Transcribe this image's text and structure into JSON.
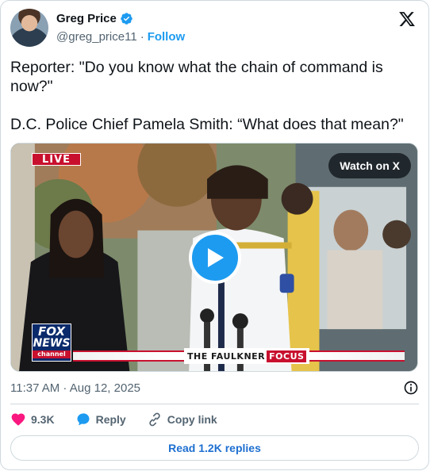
{
  "author": {
    "name": "Greg Price",
    "handle": "@greg_price11",
    "separator": "·",
    "follow_label": "Follow",
    "verified_color": "#1d9bf0"
  },
  "tweet": {
    "line1": "Reporter: \"Do you know what the chain of command is now?\"",
    "line2": "D.C. Police Chief Pamela Smith: “What does that mean?\""
  },
  "media": {
    "watch_label": "Watch on X",
    "live_label": "LIVE",
    "network_line1": "FOX",
    "network_line2": "NEWS",
    "network_line3": "channel",
    "show_part1": "THE FAULKNER",
    "show_part2": "FOCUS",
    "play_icon": "play-icon"
  },
  "timestamp": "11:37 AM · Aug 12, 2025",
  "actions": {
    "like_count": "9.3K",
    "reply_label": "Reply",
    "copy_label": "Copy link"
  },
  "read_replies_label": "Read 1.2K replies",
  "colors": {
    "accent": "#1d9bf0",
    "like": "#f91880",
    "link": "#1d6fd0"
  }
}
